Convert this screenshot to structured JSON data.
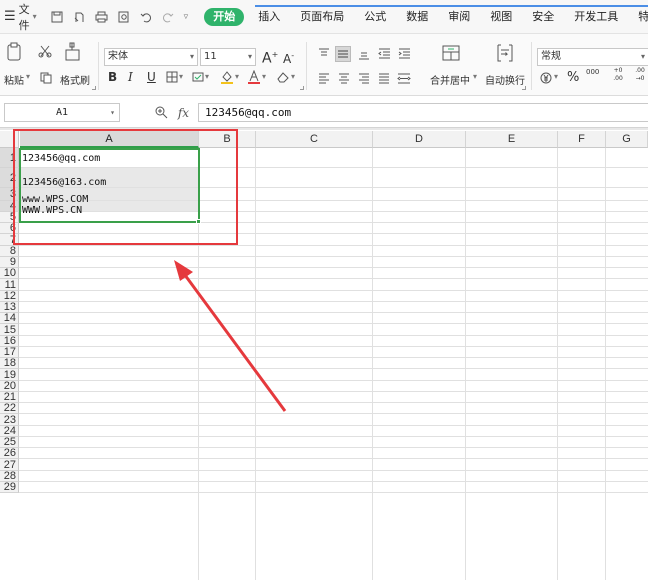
{
  "menu": {
    "file_label": "文件",
    "tabs": [
      "开始",
      "插入",
      "页面布局",
      "公式",
      "数据",
      "审阅",
      "视图",
      "安全",
      "开发工具",
      "特色应"
    ]
  },
  "ribbon": {
    "paste_label": "粘贴",
    "format_painter_label": "格式刷",
    "font_name": "宋体",
    "font_size": "11",
    "merge_label": "合并居中",
    "wrap_label": "自动换行",
    "number_format": "常规",
    "percent_symbol": "%",
    "thousands_symbol": "000",
    "inc_decimal": "+0 .00",
    "dec_decimal": ".00 →0",
    "bold": "B",
    "italic": "I",
    "underline": "U",
    "grow_font": "A",
    "shrink_font": "A"
  },
  "formula_bar": {
    "cell_ref": "A1",
    "fx_label": "fx",
    "value": "123456@qq.com"
  },
  "grid": {
    "columns": [
      "A",
      "B",
      "C",
      "D",
      "E",
      "F",
      "G"
    ],
    "rows": [
      "1",
      "2",
      "3",
      "4",
      "5",
      "6",
      "7",
      "8",
      "9",
      "10",
      "11",
      "12",
      "13",
      "14",
      "15",
      "16",
      "17",
      "18",
      "19",
      "20",
      "21",
      "22",
      "23",
      "24",
      "25",
      "26",
      "27",
      "28",
      "29"
    ],
    "cells": {
      "A1": "123456@qq.com",
      "A2": "123456@163.com",
      "A3": "www.WPS.COM",
      "A4": "WWW.WPS.CN"
    }
  },
  "colors": {
    "accent_green": "#2fb36b",
    "selection_green": "#3aa04a",
    "annotation_red": "#e5393d"
  }
}
